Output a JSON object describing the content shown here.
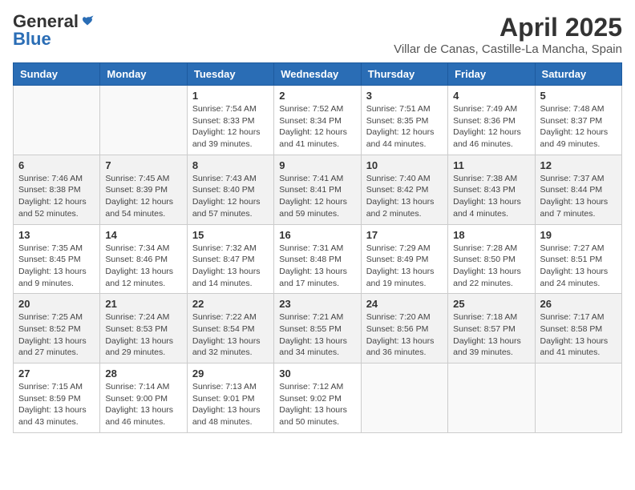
{
  "header": {
    "logo_general": "General",
    "logo_blue": "Blue",
    "month_title": "April 2025",
    "location": "Villar de Canas, Castille-La Mancha, Spain"
  },
  "weekdays": [
    "Sunday",
    "Monday",
    "Tuesday",
    "Wednesday",
    "Thursday",
    "Friday",
    "Saturday"
  ],
  "weeks": [
    {
      "shaded": false,
      "days": [
        {
          "num": "",
          "info": ""
        },
        {
          "num": "",
          "info": ""
        },
        {
          "num": "1",
          "info": "Sunrise: 7:54 AM\nSunset: 8:33 PM\nDaylight: 12 hours and 39 minutes."
        },
        {
          "num": "2",
          "info": "Sunrise: 7:52 AM\nSunset: 8:34 PM\nDaylight: 12 hours and 41 minutes."
        },
        {
          "num": "3",
          "info": "Sunrise: 7:51 AM\nSunset: 8:35 PM\nDaylight: 12 hours and 44 minutes."
        },
        {
          "num": "4",
          "info": "Sunrise: 7:49 AM\nSunset: 8:36 PM\nDaylight: 12 hours and 46 minutes."
        },
        {
          "num": "5",
          "info": "Sunrise: 7:48 AM\nSunset: 8:37 PM\nDaylight: 12 hours and 49 minutes."
        }
      ]
    },
    {
      "shaded": true,
      "days": [
        {
          "num": "6",
          "info": "Sunrise: 7:46 AM\nSunset: 8:38 PM\nDaylight: 12 hours and 52 minutes."
        },
        {
          "num": "7",
          "info": "Sunrise: 7:45 AM\nSunset: 8:39 PM\nDaylight: 12 hours and 54 minutes."
        },
        {
          "num": "8",
          "info": "Sunrise: 7:43 AM\nSunset: 8:40 PM\nDaylight: 12 hours and 57 minutes."
        },
        {
          "num": "9",
          "info": "Sunrise: 7:41 AM\nSunset: 8:41 PM\nDaylight: 12 hours and 59 minutes."
        },
        {
          "num": "10",
          "info": "Sunrise: 7:40 AM\nSunset: 8:42 PM\nDaylight: 13 hours and 2 minutes."
        },
        {
          "num": "11",
          "info": "Sunrise: 7:38 AM\nSunset: 8:43 PM\nDaylight: 13 hours and 4 minutes."
        },
        {
          "num": "12",
          "info": "Sunrise: 7:37 AM\nSunset: 8:44 PM\nDaylight: 13 hours and 7 minutes."
        }
      ]
    },
    {
      "shaded": false,
      "days": [
        {
          "num": "13",
          "info": "Sunrise: 7:35 AM\nSunset: 8:45 PM\nDaylight: 13 hours and 9 minutes."
        },
        {
          "num": "14",
          "info": "Sunrise: 7:34 AM\nSunset: 8:46 PM\nDaylight: 13 hours and 12 minutes."
        },
        {
          "num": "15",
          "info": "Sunrise: 7:32 AM\nSunset: 8:47 PM\nDaylight: 13 hours and 14 minutes."
        },
        {
          "num": "16",
          "info": "Sunrise: 7:31 AM\nSunset: 8:48 PM\nDaylight: 13 hours and 17 minutes."
        },
        {
          "num": "17",
          "info": "Sunrise: 7:29 AM\nSunset: 8:49 PM\nDaylight: 13 hours and 19 minutes."
        },
        {
          "num": "18",
          "info": "Sunrise: 7:28 AM\nSunset: 8:50 PM\nDaylight: 13 hours and 22 minutes."
        },
        {
          "num": "19",
          "info": "Sunrise: 7:27 AM\nSunset: 8:51 PM\nDaylight: 13 hours and 24 minutes."
        }
      ]
    },
    {
      "shaded": true,
      "days": [
        {
          "num": "20",
          "info": "Sunrise: 7:25 AM\nSunset: 8:52 PM\nDaylight: 13 hours and 27 minutes."
        },
        {
          "num": "21",
          "info": "Sunrise: 7:24 AM\nSunset: 8:53 PM\nDaylight: 13 hours and 29 minutes."
        },
        {
          "num": "22",
          "info": "Sunrise: 7:22 AM\nSunset: 8:54 PM\nDaylight: 13 hours and 32 minutes."
        },
        {
          "num": "23",
          "info": "Sunrise: 7:21 AM\nSunset: 8:55 PM\nDaylight: 13 hours and 34 minutes."
        },
        {
          "num": "24",
          "info": "Sunrise: 7:20 AM\nSunset: 8:56 PM\nDaylight: 13 hours and 36 minutes."
        },
        {
          "num": "25",
          "info": "Sunrise: 7:18 AM\nSunset: 8:57 PM\nDaylight: 13 hours and 39 minutes."
        },
        {
          "num": "26",
          "info": "Sunrise: 7:17 AM\nSunset: 8:58 PM\nDaylight: 13 hours and 41 minutes."
        }
      ]
    },
    {
      "shaded": false,
      "days": [
        {
          "num": "27",
          "info": "Sunrise: 7:15 AM\nSunset: 8:59 PM\nDaylight: 13 hours and 43 minutes."
        },
        {
          "num": "28",
          "info": "Sunrise: 7:14 AM\nSunset: 9:00 PM\nDaylight: 13 hours and 46 minutes."
        },
        {
          "num": "29",
          "info": "Sunrise: 7:13 AM\nSunset: 9:01 PM\nDaylight: 13 hours and 48 minutes."
        },
        {
          "num": "30",
          "info": "Sunrise: 7:12 AM\nSunset: 9:02 PM\nDaylight: 13 hours and 50 minutes."
        },
        {
          "num": "",
          "info": ""
        },
        {
          "num": "",
          "info": ""
        },
        {
          "num": "",
          "info": ""
        }
      ]
    }
  ]
}
